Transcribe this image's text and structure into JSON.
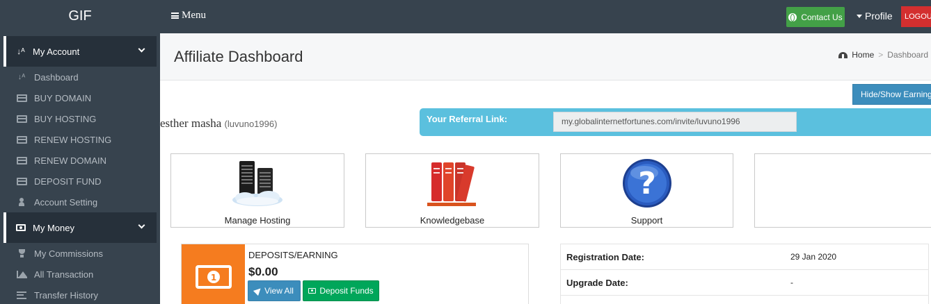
{
  "brand": "GIF",
  "header": {
    "menu_label": "Menu",
    "contact_label": "Contact Us",
    "profile_label": "Profile",
    "logout_label": "LOGOUT",
    "colors": {
      "bar": "#37434e",
      "contact": "#43a047",
      "logout": "#d32f2f"
    }
  },
  "sidebar": {
    "account_section": "My Account",
    "account_items": [
      {
        "label": "Dashboard",
        "icon": "sort-alpha-icon"
      },
      {
        "label": "BUY DOMAIN",
        "icon": "credit-card-icon"
      },
      {
        "label": "BUY HOSTING",
        "icon": "credit-card-icon"
      },
      {
        "label": "RENEW HOSTING",
        "icon": "credit-card-icon"
      },
      {
        "label": "RENEW DOMAIN",
        "icon": "credit-card-icon"
      },
      {
        "label": "DEPOSIT FUND",
        "icon": "credit-card-icon"
      },
      {
        "label": "Account Setting",
        "icon": "user-icon"
      }
    ],
    "money_section": "My Money",
    "money_items": [
      {
        "label": "My Commissions",
        "icon": "trophy-icon"
      },
      {
        "label": "All Transaction",
        "icon": "area-chart-icon"
      },
      {
        "label": "Transfer History",
        "icon": "list-icon"
      }
    ]
  },
  "page": {
    "title": "Affiliate Dashboard",
    "breadcrumb_home": "Home",
    "breadcrumb_separator": ">",
    "breadcrumb_current": "Dashboard",
    "earning_toggle": "Hide/Show Earning"
  },
  "user": {
    "name": "esther masha",
    "username": "(luvuno1996)"
  },
  "referral": {
    "label": "Your Referral Link:",
    "link": "my.globalinternetfortunes.com/invite/luvuno1996"
  },
  "tiles": [
    {
      "label": "Manage Hosting",
      "icon": "server-cloud-icon"
    },
    {
      "label": "Knowledgebase",
      "icon": "books-icon"
    },
    {
      "label": "Support",
      "icon": "question-icon"
    },
    {
      "label": "",
      "icon": ""
    }
  ],
  "deposits": {
    "title": "DEPOSITS/EARNING",
    "amount": "$0.00",
    "view_all": "View All",
    "deposit_funds": "Deposit Funds",
    "accent": "#f57c1f"
  },
  "info": [
    {
      "key": "Registration Date:",
      "value": "29 Jan 2020"
    },
    {
      "key": "Upgrade Date:",
      "value": "-"
    }
  ]
}
